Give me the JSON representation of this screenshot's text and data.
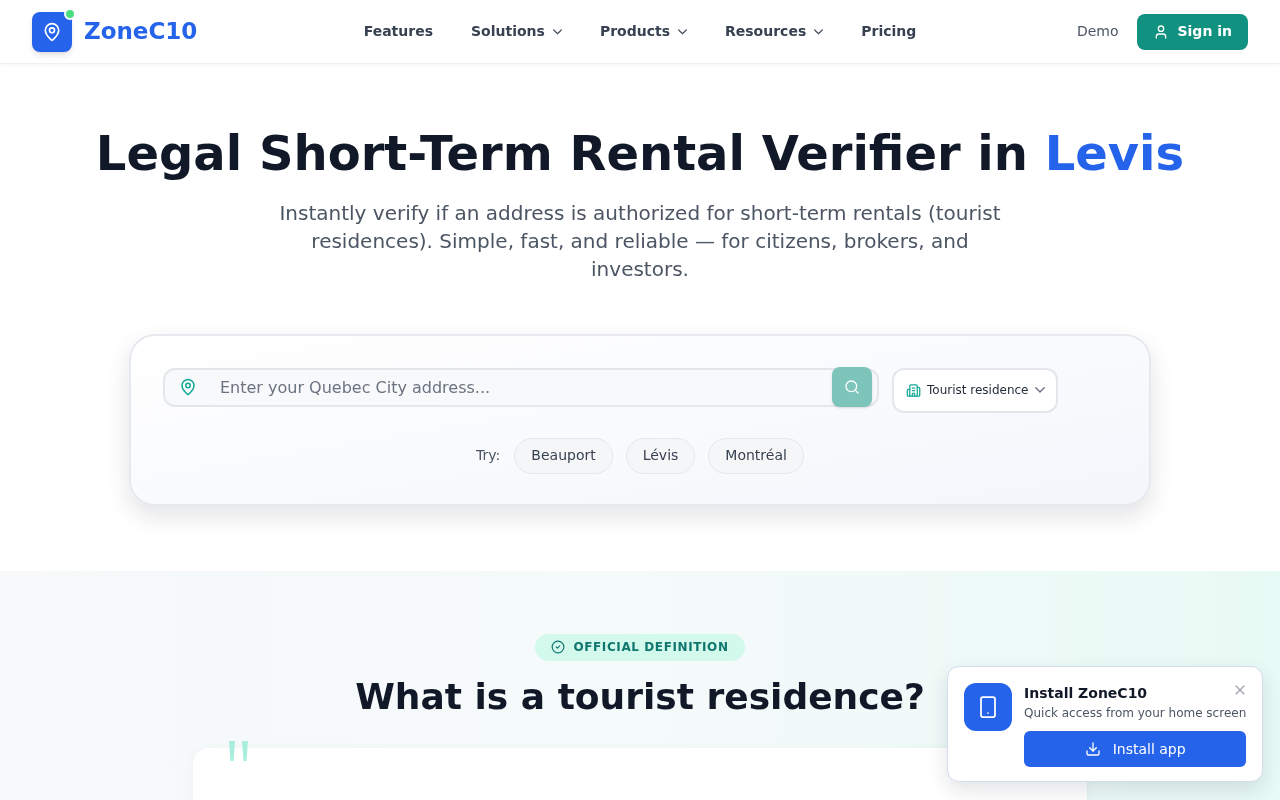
{
  "header": {
    "brand": "ZoneC10",
    "nav": [
      {
        "label": "Features",
        "has_menu": false
      },
      {
        "label": "Solutions",
        "has_menu": true
      },
      {
        "label": "Products",
        "has_menu": true
      },
      {
        "label": "Resources",
        "has_menu": true
      },
      {
        "label": "Pricing",
        "has_menu": false
      }
    ],
    "demo_link": "Demo",
    "sign_in": "Sign in"
  },
  "hero": {
    "title": "Legal Short-Term Rental Verifier in",
    "title_highlight": "Levis",
    "subtitle": "Instantly verify if an address is authorized for short-term rentals (tourist residences). Simple, fast, and reliable — for citizens, brokers, and investors."
  },
  "search": {
    "placeholder": "Enter your Quebec City address...",
    "type_select": "Tourist residence",
    "try_label": "Try:",
    "suggestions": [
      "Beauport",
      "Lévis",
      "Montréal"
    ]
  },
  "definition": {
    "badge": "OFFICIAL DEFINITION",
    "heading": "What is a tourist residence?"
  },
  "install_prompt": {
    "title": "Install ZoneC10",
    "subtitle": "Quick access from your home screen",
    "button": "Install app"
  }
}
